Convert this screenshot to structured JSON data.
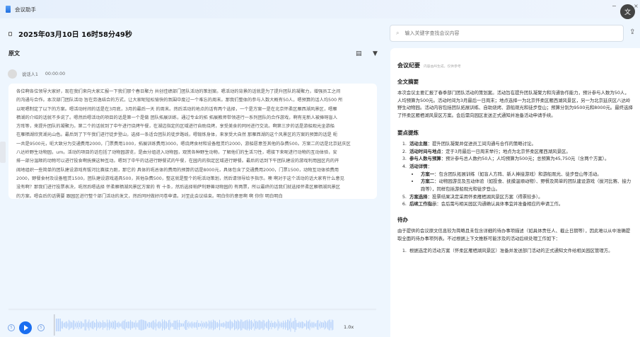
{
  "app": {
    "title": "会议助手",
    "minimize": "−",
    "close": "×",
    "translate_icon": "文"
  },
  "header": {
    "datetime": "2025年03月10日 16时58分49秒"
  },
  "transcript": {
    "section_title": "原文",
    "speaker": "说话人1",
    "timestamp": "00:00:00",
    "lines": [
      "各位啊各位领导大家好，现在我们来向大家汇报一下我们那个春日聚力 共创佳绩部门团队活动的策划案。嗯活动的背景的话就是为了提升团队的凝聚力，增强员工之间",
      "的沟通与合作。本次部门团队活动 旨在劳逸结合的方式，让大家呢轻松愉快的氛围中度过一个难忘的周末。那我们整体的参与人数大概有50人，嗯预算的话人均500 所",
      "以呢嗯制定了以下的方案。嗯活动时间的话是在3月底，3月的最后一天 的周末。然后活动的地点的话有两个选择，一个是方案一是在北京怀柔区雁西湖风景区，嗯雁",
      "栖湖的介绍的话就不多说了。嗯然后嗯活动的项目的话是第一个是做 团队拓展训练，通过专业的拓 拓展教师带领进行一系列团队的合作游戏，啊有无新人被捧呀盲人",
      "方阵等，来提升团队的凝聚力。第二个的话就到了中午进行烧烤午餐，在湖边指定的区域进行自助烧烤，享受美食的同时进行交流。啊第三步的话是游船观光坐游船",
      "在雁栖湖欣赏湖光山色。最后到了下午我们进行徒步登山，选择一条适合团队的徒步路线，嗯锻炼身体，来享受大自然 那雁西湖的这个风景区的方案的预算的话是 呃",
      "一共是9500元，呃大致分为交通费用2000，门票费用1000，拓展训练费用3000，嗯烧烤食材和设备租赁约2000，游船愿意签其他的杂费500。方案二的话是北京延庆区",
      "八达岭野生动物园，um。活动的项目的话包括了动物园游览，是由分组进入动物园，观赏各种野生动物，了解他们的生活习性，嗯接下来呢进行动物的互动体验，安",
      "排一部分温顺的动物可以进行投食啊抚摸这种互动。嗯到了中午的话进行野餐式的午餐，在园内的指定区域进行野餐。最后的话到下午团队建设的游戏利用园区内的开",
      "阔地组织一些简单的团队建设游戏有拔河比赛接力跑，那它的 具体的呃总体的费用的预算的话是8000元，具体包含了交通费用2000，门票1500，动物互动体验费用",
      "2000，野餐食材及设备租赁1500，团队建设游戏道具500，其他杂费500，整这就是整个的呃活动策划，然后请领导给予指示。噢 啊对于这个活动的话大家有什么意见",
      "没有啊？那我们进行投票表决，呃然后嗯选择 怀柔雁栖湖风景区方案的 有 十条，然后选择帕萨利野兽动物园的 有两票，所以最终的话我们就选择怀柔区雁栖湖风景区",
      "的方案。嗯会后的话需要 跟园区进行整个部门活动的发文，然后同时做好问卷申请。对至此会议结束。明白你的意思啊 啊 你你 明白明白"
    ]
  },
  "search": {
    "placeholder": "输入关键字查找会议内容"
  },
  "minutes": {
    "title": "会议纪要",
    "note": "内容由AI生成，仅供参考",
    "summary_title": "全文摘要",
    "summary": "本次会议主要汇报了春季部门团队活动的策划案。活动旨在提升团队凝聚力和沟通协作能力，预计参与人数为50人，人均预算为500元。活动时间为3月最后一日周末；地点选择一为北京怀柔区雁西湖风景区，另一为北京延庆区八达岭野生动物园。活动内容包括团队拓展训练、自助烧烤、游船观光和徒步登山；预算分别为9500元和8000元。最终选择了怀柔区雁栖湖风景区方案。会后需向园区发送正式通知并准备活动申请手续。",
    "points_title": "要点提炼",
    "points": [
      {
        "label": "活动主题",
        "text": "：提升团队凝聚并促进员工间沟通与合作的策略讨论。"
      },
      {
        "label": "活动时间与地点",
        "text": "：定于3月最后一日周末举行；地点为北京怀柔区雁西湖风景区。"
      },
      {
        "label": "参与人数与预算",
        "text": "：预计参与总人数约50人；人均预算为500元；总预算为45,750元（含两个方案）。"
      },
      {
        "label": "活动详情",
        "text": "："
      },
      {
        "label": "方案选择",
        "text": "：投票结果决定采用怀柔雁栖湖风景区方案（得票较多）。"
      },
      {
        "label": "后续工作指示",
        "text": "：会后需与相关园区沟通确认具体事宜并准备相应的申请工作。"
      }
    ],
    "details": [
      {
        "label": "方案一",
        "text": "：包含团队拓展训练（如盲人方阵、新人捧接游戏）和游船观光、徒步登山等活动。"
      },
      {
        "label": "方案二",
        "text": "：动物园游览及互动体验（如投食、抚摸温顺动物）、野餐及简单的团队建设游戏（拔河比赛、接力跑等），同样包括游船观光和徒步登山。"
      }
    ],
    "todo_title": "待办",
    "todo_intro": "由于提供的会议原文信息较为简略且未包含详细的待办事项描述（如具体责任人、截止日期等），因此难以从中准确提取全面的待办事项列表。不过根据上下文推断可能涉及的活动后续处理工作如下：",
    "todos": [
      "根据选定的活动方案（怀柔区雁栖湖风景区）准备并发送部门活动的正式通知文件给相关园区管理方。"
    ]
  },
  "player": {
    "speed": "1.0x",
    "back_icon": "5",
    "fwd_icon": "5"
  },
  "colors": {
    "accent": "#1a6ef0",
    "wave": "#b5d0fb"
  }
}
